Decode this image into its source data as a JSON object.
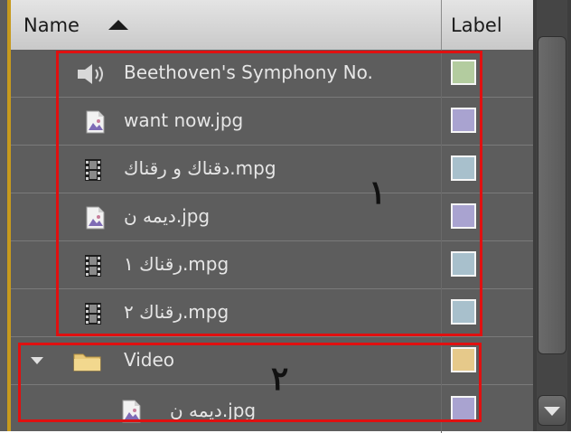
{
  "header": {
    "name_label": "Name",
    "label_col": "Label",
    "sort_icon": "sort-ascending-icon"
  },
  "rows": [
    {
      "name": "Beethoven's Symphony No.",
      "icon": "audio-icon",
      "label_color": "#b3cc9f"
    },
    {
      "name": "want now.jpg",
      "icon": "image-file-icon",
      "label_color": "#a9a3d0"
    },
    {
      "name": "دقناك و رقناك.mpg",
      "icon": "film-strip-icon",
      "label_color": "#a8c0cc"
    },
    {
      "name": "دیمه ن.jpg",
      "icon": "image-file-icon",
      "label_color": "#a9a3d0"
    },
    {
      "name": "رقناك ١.mpg",
      "icon": "film-strip-icon",
      "label_color": "#a8c0cc"
    },
    {
      "name": "رقناك ٢.mpg",
      "icon": "film-strip-icon",
      "label_color": "#a8c0cc"
    }
  ],
  "folder": {
    "name": "Video",
    "icon": "folder-icon",
    "label_color": "#e6c98a",
    "expanded": true,
    "children": [
      {
        "name": "دیمه ن.jpg",
        "icon": "image-file-icon",
        "label_color": "#a9a3d0"
      }
    ]
  },
  "annotations": {
    "box1_number": "١",
    "box2_number": "٢",
    "box_color": "#e01010"
  }
}
